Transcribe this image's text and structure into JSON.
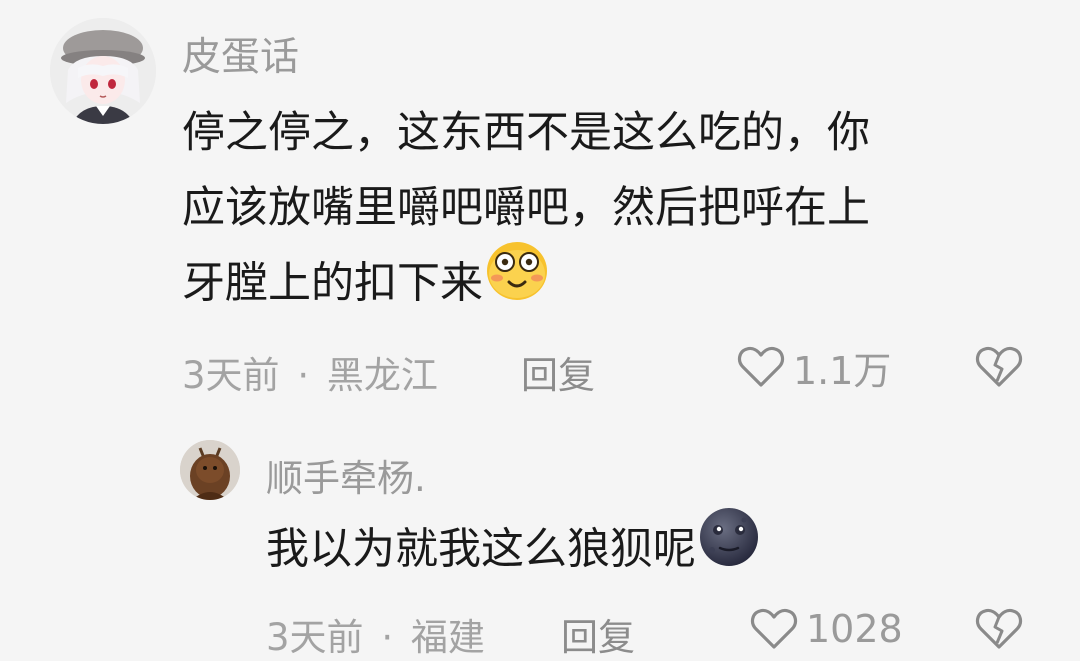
{
  "comments": [
    {
      "username": "皮蛋话",
      "content_lines": [
        "停之停之，这东西不是这么吃的，你",
        "应该放嘴里嚼吧嚼吧，然后把呼在上",
        "牙膛上的扣下来"
      ],
      "emoji": "flushed-face",
      "time": "3天前",
      "separator": "·",
      "location": "黑龙江",
      "reply_label": "回复",
      "likes": "1.1万"
    },
    {
      "username": "顺手牵杨.",
      "content_lines": [
        "我以为就我这么狼狈呢"
      ],
      "emoji": "new-moon-face",
      "time": "3天前",
      "separator": "·",
      "location": "福建",
      "reply_label": "回复",
      "likes": "1028"
    }
  ],
  "icons": {
    "like": "heart-outline-icon",
    "dislike": "broken-heart-icon"
  },
  "colors": {
    "background": "#f5f5f5",
    "text": "#1a1a1a",
    "secondary": "#9a9a9a"
  }
}
